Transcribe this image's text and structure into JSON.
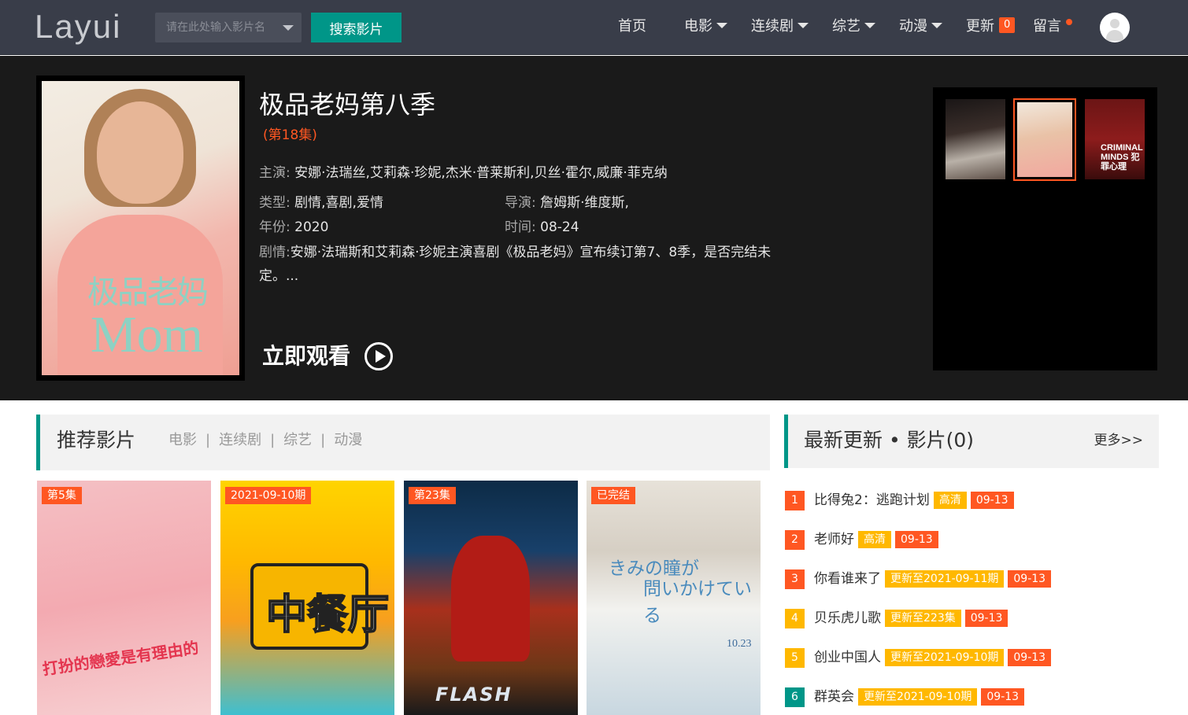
{
  "header": {
    "logo": "Layui",
    "search_placeholder": "请在此处输入影片名",
    "search_button": "搜索影片",
    "nav": [
      {
        "label": "首页"
      },
      {
        "label": "电影"
      },
      {
        "label": "连续剧"
      },
      {
        "label": "综艺"
      },
      {
        "label": "动漫"
      },
      {
        "label": "更新",
        "badge": "0"
      },
      {
        "label": "留言"
      }
    ],
    "accent": "#009688",
    "alert_color": "#ff5722"
  },
  "hero": {
    "title": "极品老妈第八季",
    "episode": "(第18集)",
    "poster_text1": "极品老妈",
    "poster_text2": "Mom",
    "cast_label": "主演:",
    "cast": "安娜·法瑞丝,艾莉森·珍妮,杰米·普莱斯利,贝丝·霍尔,威廉·菲克纳",
    "genre_label": "类型:",
    "genre": "剧情,喜剧,爱情",
    "director_label": "导演:",
    "director": "詹姆斯·维度斯,",
    "year_label": "年份:",
    "year": "2020",
    "time_label": "时间:",
    "time": "08-24",
    "plot_label": "剧情:",
    "plot": "安娜·法瑞斯和艾莉森·珍妮主演喜剧《极品老妈》宣布续订第7、8季，是否完结未定。...",
    "watch_label": "立即观看",
    "thumb3_text": "CRIMINAL MINDS 犯罪心理"
  },
  "recommend": {
    "title": "推荐影片",
    "categories": [
      "电影",
      "连续剧",
      "综艺",
      "动漫"
    ],
    "separator": "|",
    "cards": [
      {
        "badge": "第5集",
        "poster_text": "打扮的戀愛是有理由的"
      },
      {
        "badge": "2021-09-10期",
        "poster_text": "中餐厅"
      },
      {
        "badge": "第23集",
        "poster_text": "FLASH"
      },
      {
        "badge": "已完结",
        "poster_text1": "きみの瞳が",
        "poster_text2": "問いかけている",
        "poster_date": "10.23"
      }
    ]
  },
  "latest": {
    "title": "最新更新 • 影片(0)",
    "more": "更多>>",
    "items": [
      {
        "rank": "1",
        "name": "比得兔2：逃跑计划",
        "tag": "高清",
        "date": "09-13"
      },
      {
        "rank": "2",
        "name": "老师好",
        "tag": "高清",
        "date": "09-13"
      },
      {
        "rank": "3",
        "name": "你看谁来了",
        "tag": "更新至2021-09-11期",
        "date": "09-13"
      },
      {
        "rank": "4",
        "name": "贝乐虎儿歌",
        "tag": "更新至223集",
        "date": "09-13"
      },
      {
        "rank": "5",
        "name": "创业中国人",
        "tag": "更新至2021-09-10期",
        "date": "09-13"
      },
      {
        "rank": "6",
        "name": "群英会",
        "tag": "更新至2021-09-10期",
        "date": "09-13"
      }
    ]
  }
}
